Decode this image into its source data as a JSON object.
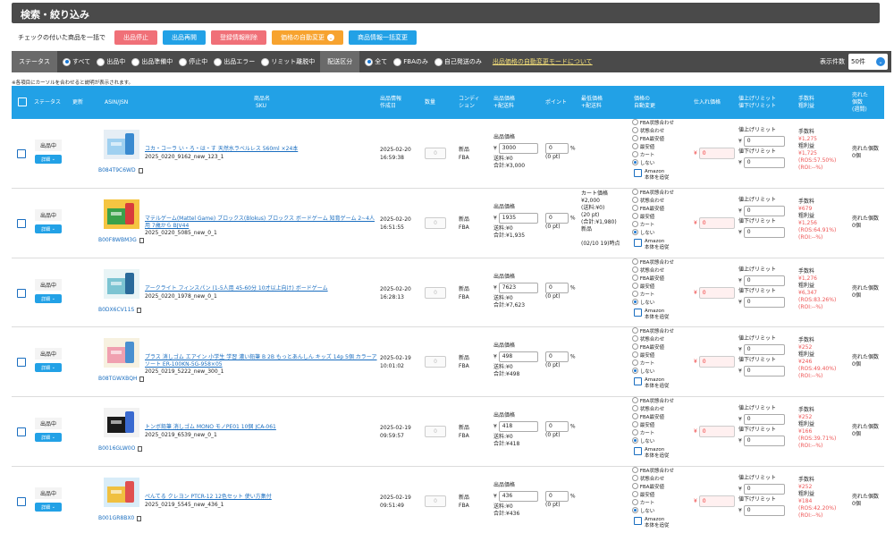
{
  "section_title": "検索・絞り込み",
  "bulk": {
    "label": "チェックの付いた商品を一括で",
    "stop": "出品停止",
    "resume": "出品再開",
    "delete": "登録情報削除",
    "auto_price": "価格の自動変更",
    "auto_price_icon": "chevron-down-icon",
    "bulk_change": "商品情報一括変更"
  },
  "filter": {
    "status_label": "ステータス",
    "status_options": [
      "すべて",
      "出品中",
      "出品準備中",
      "停止中",
      "出品エラー",
      "リミット離脱中"
    ],
    "ship_label": "配送区分",
    "ship_options": [
      "全て",
      "FBAのみ",
      "自己発送のみ"
    ],
    "link": "出品価格の自動変更モードについて",
    "count_label": "表示件数",
    "count_value": "50件"
  },
  "note": "※各項目にカーソルを合わせると説明が表示されます。",
  "columns": {
    "status": "ステータス",
    "update": "更新",
    "asin": "ASIN/JSN",
    "name": "商品名",
    "sku": "SKU",
    "listed1": "出品情報",
    "listed2": "作成日",
    "qty": "数量",
    "cond1": "コンディ",
    "cond2": "ション",
    "price1": "出品価格",
    "price2": "+配送料",
    "point": "ポイント",
    "low1": "最低価格",
    "low2": "+配送料",
    "auto1": "価格の",
    "auto2": "自動変更",
    "cost": "仕入れ価格",
    "lim1": "値上げリミット",
    "lim2": "値下げリミット",
    "fee1": "手数料",
    "fee2": "粗利益",
    "sold1": "売れた",
    "sold2": "個数",
    "sold3": "(週間)"
  },
  "row_labels": {
    "detail": "詳細",
    "price_label": "出品価格",
    "yen": "¥",
    "shipping": "送料:¥0",
    "pt_unit": "%",
    "amazon1": "Amazon",
    "amazon2": "本体を追従",
    "auto_options": [
      "FBA状態合わせ",
      "状態合わせ",
      "FBA最安値",
      "最安値",
      "カート",
      "しない"
    ],
    "raise": "値上げリミット",
    "lower": "値下げリミット",
    "fee": "手数料",
    "profit": "粗利益",
    "sold": "売れた個数",
    "qty": "0",
    "cond1": "新品",
    "cond2": "FBA",
    "zero": "0"
  },
  "rows": [
    {
      "status": "出品中",
      "asin": "B084T9C6WD",
      "title": "コカ・コーラ い・ろ・は・す 天然水ラベルレス 560ml ×24本",
      "sku": "2025_0220_9162_new_123_1",
      "date": "2025-02-20",
      "time": "16:59:38",
      "price": "3000",
      "total": "合計:¥3,000",
      "pt": "(0 pt)",
      "cart": [],
      "fee": "¥1,275",
      "profit": "¥1,725",
      "ros": "(ROS:57.50%)",
      "roi": "(ROI:--%)",
      "sold": "0個"
    },
    {
      "status": "出品中",
      "asin": "B00F8WBM3G",
      "title": "マテルゲーム(Mattel Game) ブロックス(Blokus) ブロックス ボードゲーム 知育ゲーム 2~4人用 7歳から BJV44",
      "sku": "2025_0220_5085_new_0_1",
      "date": "2025-02-20",
      "time": "16:51:55",
      "price": "1935",
      "total": "合計:¥1,935",
      "pt": "(0 pt)",
      "cart": [
        "カート価格",
        "¥2,000",
        "(送料:¥0)",
        "(20 pt)",
        "(合計:¥1,980)",
        "新品",
        "",
        "(02/10 19)時点"
      ],
      "fee": "¥679",
      "profit": "¥1,256",
      "ros": "(ROS:64.91%)",
      "roi": "(ROI:--%)",
      "sold": "0個"
    },
    {
      "status": "出品中",
      "asin": "B0DX6CV11S",
      "title": "アークライト フィンスパン (1-5人用 45-60分 10才以上向け) ボードゲーム",
      "sku": "2025_0220_1978_new_0_1",
      "date": "2025-02-20",
      "time": "16:28:13",
      "price": "7623",
      "total": "合計:¥7,623",
      "pt": "(0 pt)",
      "cart": [],
      "fee": "¥1,276",
      "profit": "¥6,347",
      "ros": "(ROS:83.26%)",
      "roi": "(ROI:--%)",
      "sold": "0個"
    },
    {
      "status": "出品中",
      "asin": "B08TGWXBQH",
      "title": "プラス 消しゴム エアイン 小学生 学習 濃い鉛筆 B 2B もっとあんしん キッズ 14p 5個 カラーアソート ER-100KN-5G-958×05",
      "sku": "2025_0219_5222_new_300_1",
      "date": "2025-02-19",
      "time": "10:01:02",
      "price": "498",
      "total": "合計:¥498",
      "pt": "(0 pt)",
      "cart": [],
      "fee": "¥252",
      "profit": "¥246",
      "ros": "(ROS:49.40%)",
      "roi": "(ROI:--%)",
      "sold": "0個"
    },
    {
      "status": "出品中",
      "asin": "B0016GLW0O",
      "title": "トンボ鉛筆 消しゴム MONO モノPE01 10個 JCA-061",
      "sku": "2025_0219_6539_new_0_1",
      "date": "2025-02-19",
      "time": "09:59:57",
      "price": "418",
      "total": "合計:¥418",
      "pt": "(0 pt)",
      "cart": [],
      "fee": "¥252",
      "profit": "¥166",
      "ros": "(ROS:39.71%)",
      "roi": "(ROI:--%)",
      "sold": "0個"
    },
    {
      "status": "出品中",
      "asin": "B001GR8BX0",
      "title": "ぺんてる クレヨン PTCR-12 12色セット 使い方集付",
      "sku": "2025_0219_5545_new_436_1",
      "date": "2025-02-19",
      "time": "09:51:49",
      "price": "436",
      "total": "合計:¥436",
      "pt": "(0 pt)",
      "cart": [],
      "fee": "¥252",
      "profit": "¥184",
      "ros": "(ROS:42.20%)",
      "roi": "(ROI:--%)",
      "sold": "0個"
    }
  ],
  "colors": {
    "header_bg": "#4a4a4a",
    "table_head": "#22a1e6",
    "red_btn": "#f07078",
    "orange_btn": "#f7a32f"
  }
}
